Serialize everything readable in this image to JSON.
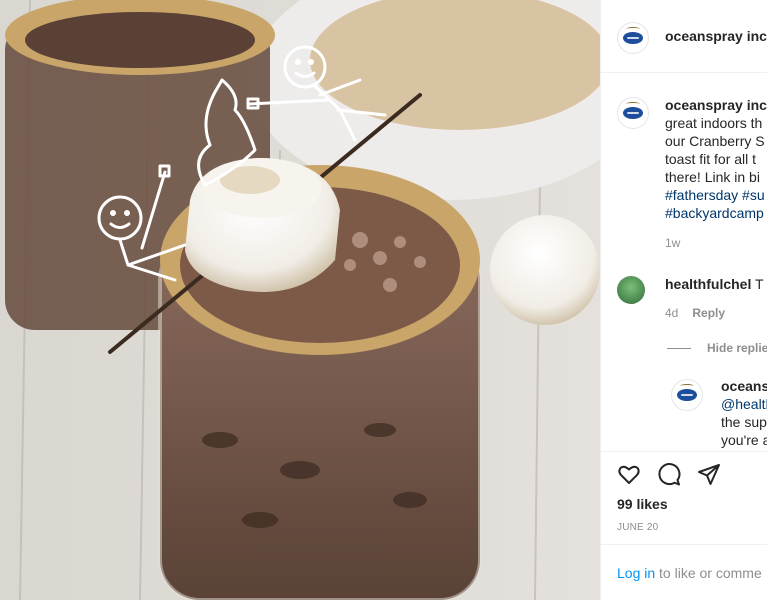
{
  "account": {
    "username": "oceanspray inc"
  },
  "caption": {
    "username": "oceanspray inc",
    "lines": [
      "great indoors th",
      "our Cranberry S",
      "toast fit for all t",
      "there! Link in bi"
    ],
    "tags": [
      "#fathersday #su",
      "#backyardcamp"
    ],
    "time": "1w"
  },
  "comments": [
    {
      "username": "healthfulchel",
      "text": "T",
      "time": "4d",
      "reply_label": "Reply"
    }
  ],
  "hide_replies_label": "Hide replie",
  "reply": {
    "username": "oceans",
    "lines": [
      "@healtl",
      "the sup",
      "you're a"
    ]
  },
  "likes_label": "99 likes",
  "date": "JUNE 20",
  "login_prompt": {
    "link": "Log in",
    "rest": " to like or comme"
  },
  "icons": [
    "heart-icon",
    "comment-icon",
    "share-icon"
  ],
  "colors": {
    "link": "#0095f6",
    "hashtag": "#00376b",
    "muted": "#8e8e8e"
  }
}
